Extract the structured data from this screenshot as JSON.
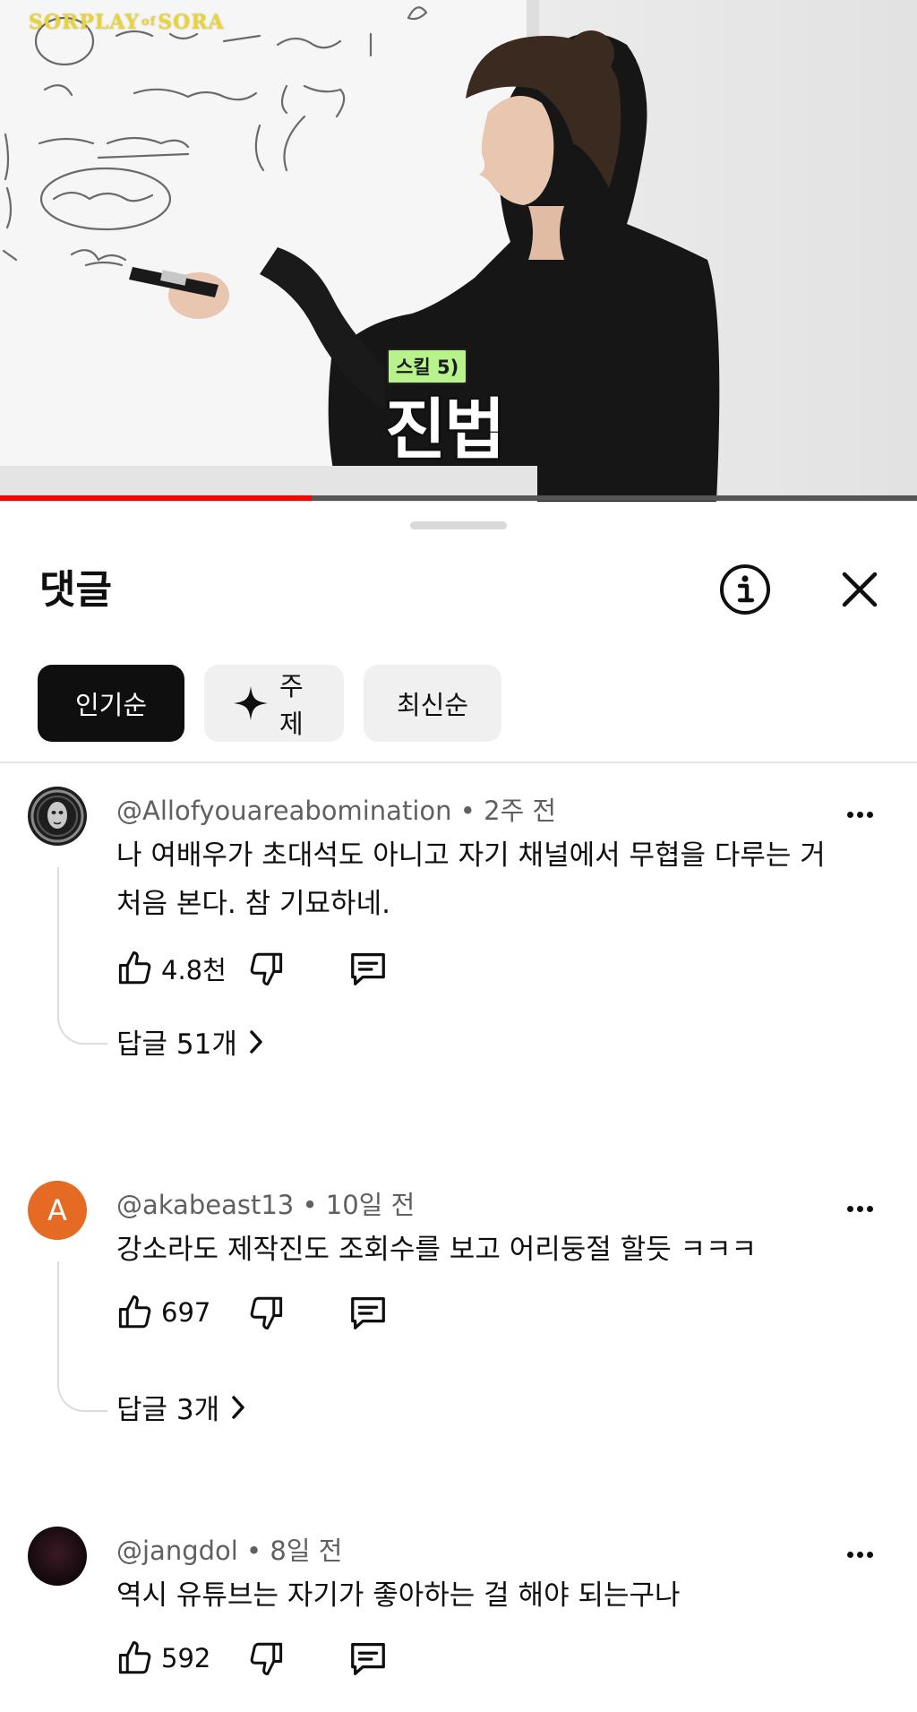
{
  "video": {
    "channel_logo": "SORPLAY of SORA",
    "logo_main": "SORPLAY",
    "logo_of": "of",
    "logo_tail": "SORA",
    "caption_tag": "스킬 5)",
    "caption_main": "진법",
    "whiteboard_lines": [
      "검법 · 무공의 기초, 걸음마",
      "신법 · 맞벌어지씨 (가오 있는)",
      "3. 검법, 도법",
      "4. 권법, 장법",
      "5. 진법"
    ],
    "progress": 0.34
  },
  "sheet": {
    "title": "댓글",
    "info_icon": "info-icon",
    "close_icon": "close-icon"
  },
  "chips": [
    {
      "label": "인기순",
      "active": true
    },
    {
      "label": "주제",
      "icon": "sparkle-icon",
      "active": false
    },
    {
      "label": "최신순",
      "active": false
    }
  ],
  "comments": [
    {
      "author": "@Allofyouareabomination",
      "time": "2주 전",
      "text": "나 여배우가 초대석도 아니고 자기 채널에서 무협을 다루는 거 처음 본다. 참 기묘하네.",
      "likes": "4.8천",
      "replies": "답글 51개"
    },
    {
      "author": "@akabeast13",
      "time": "10일 전",
      "avatar_letter": "A",
      "text": "강소라도 제작진도 조회수를 보고 어리둥절 할듯 ㅋㅋㅋ",
      "likes": "697",
      "replies": "답글 3개"
    },
    {
      "author": "@jangdol",
      "time": "8일 전",
      "text": "역시 유튜브는 자기가 좋아하는 걸 해야 되는구나",
      "likes": "592"
    }
  ],
  "colors": {
    "accent_red": "#ff0000",
    "chip_active_bg": "#0f0f0f",
    "chip_bg": "#f0f0f0",
    "meta_gray": "#606060",
    "avatar_orange": "#e56a24"
  }
}
